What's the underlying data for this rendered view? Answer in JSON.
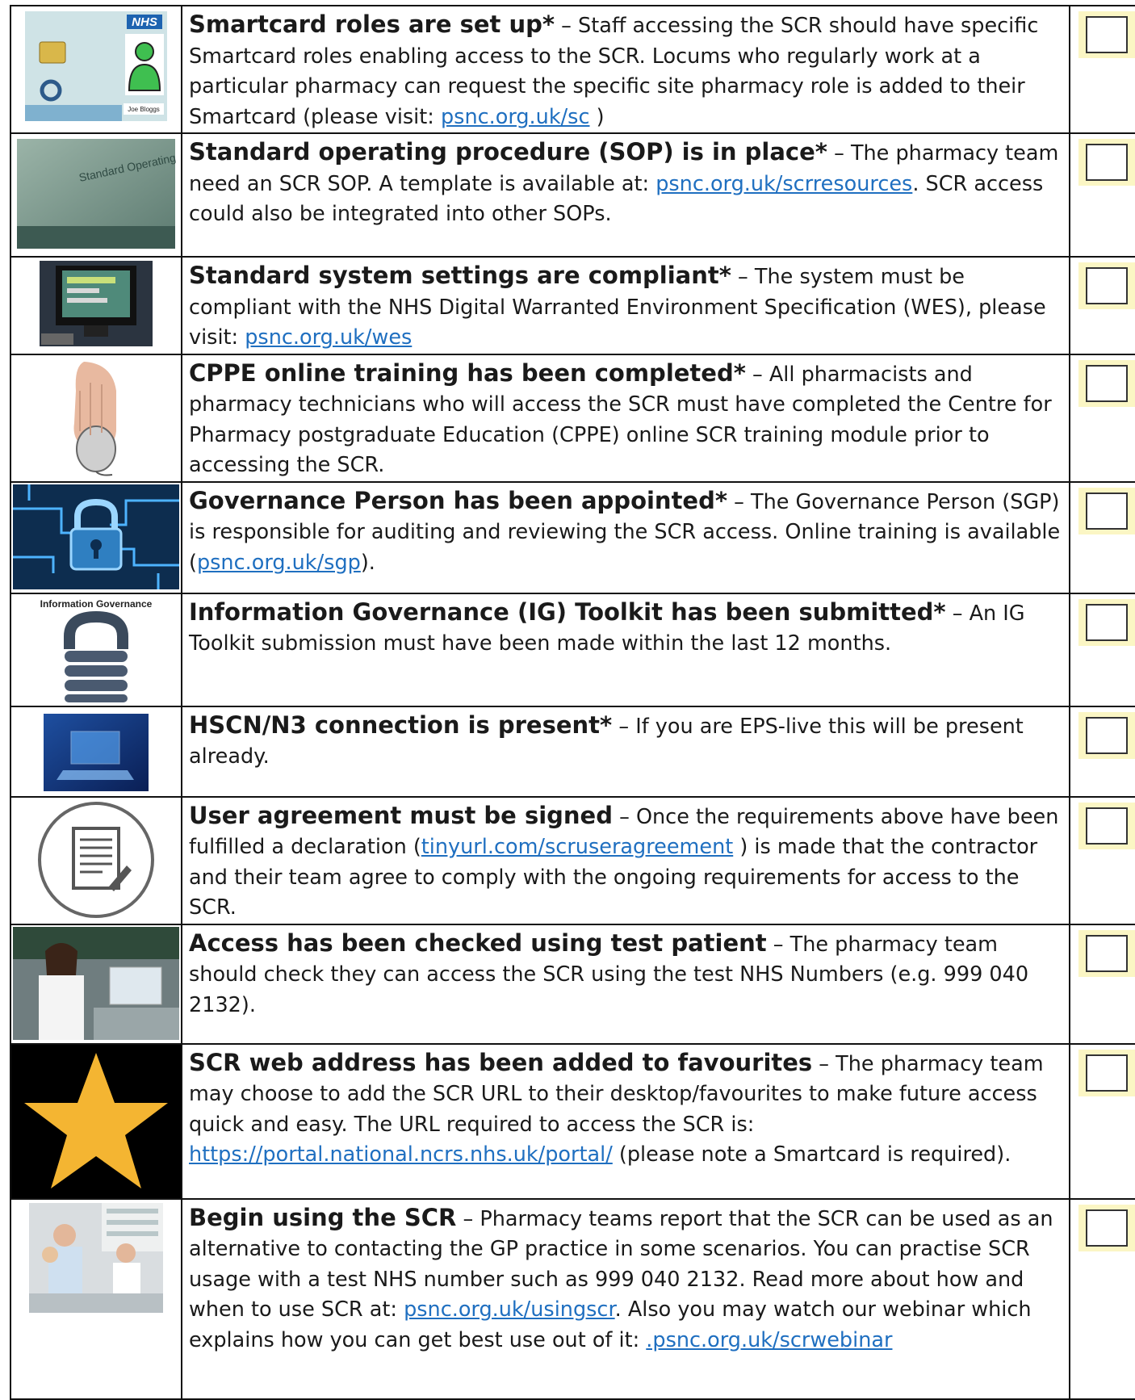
{
  "items": [
    {
      "title": "Smartcard roles are set up*",
      "dash": " – ",
      "body": "Staff accessing the SCR should have specific Smartcard roles enabling access to the SCR. Locums who regularly work at a particular pharmacy can request the specific site pharmacy role is added to their Smartcard (please visit: ",
      "link": "psnc.org.uk/sc",
      "after": " )",
      "image": {
        "icon": "nhs-smartcard-image",
        "nhs_label": "NHS",
        "card_name": "Joe Bloggs"
      }
    },
    {
      "title": "Standard operating procedure (SOP) is in place*",
      "dash": " – ",
      "body": "The pharmacy team need an SCR SOP. A template is available at: ",
      "link": "psnc.org.uk/scrresources",
      "after": ". SCR access could also be integrated into other SOPs.",
      "image": {
        "icon": "sop-binder-image",
        "caption": "Standard Operating Procedures"
      }
    },
    {
      "title": "Standard system settings are compliant*",
      "dash": " – ",
      "body": "The system must be compliant with the NHS Digital Warranted Environment Specification (WES), please visit: ",
      "link": "psnc.org.uk/wes",
      "after": "",
      "image": {
        "icon": "computer-monitor-image"
      }
    },
    {
      "title": "CPPE online training has been completed*",
      "dash": " – ",
      "body": "All pharmacists and pharmacy technicians who will access the SCR must have completed the Centre for Pharmacy postgraduate Education (CPPE) online SCR training module prior to accessing the SCR.",
      "link": "",
      "after": "",
      "image": {
        "icon": "hand-mouse-image"
      }
    },
    {
      "title": "Governance Person has been appointed*",
      "dash": " – ",
      "body": "The Governance Person (SGP) is responsible for auditing and reviewing the SCR access. Online training is available (",
      "link": "psnc.org.uk/sgp",
      "after": ").",
      "image": {
        "icon": "circuit-padlock-image"
      }
    },
    {
      "title": "Information Governance (IG) Toolkit has been submitted*",
      "dash": " – ",
      "body": "An IG Toolkit submission must have been made within the last 12 months.",
      "link": "",
      "after": "",
      "image": {
        "icon": "information-governance-lock-image",
        "caption": "Information Governance"
      }
    },
    {
      "title": "HSCN/N3 connection is present*",
      "dash": " – ",
      "body": "If you are EPS-live this will be present already.",
      "link": "",
      "after": "",
      "image": {
        "icon": "laptop-network-image"
      }
    },
    {
      "title": "User agreement must be signed",
      "dash": " – ",
      "body": "Once the requirements above have been fulfilled a declaration (",
      "link": "tinyurl.com/scruseragreement",
      "after": " ) is made that the contractor and their team agree to comply with the ongoing requirements for access to the SCR.",
      "image": {
        "icon": "signed-document-icon"
      }
    },
    {
      "title": "Access has been checked using test patient",
      "dash": " – ",
      "body": "The pharmacy team should check they can access the SCR using the test NHS Numbers (e.g. 999 040 2132).",
      "link": "",
      "after": "",
      "image": {
        "icon": "pharmacist-at-computer-image"
      }
    },
    {
      "title": "SCR web address has been added to favourites",
      "dash": " – ",
      "body": "The pharmacy team may choose to add the SCR URL to their desktop/favourites to make future access quick and easy. The URL required to access the SCR is: ",
      "link": "https://portal.national.ncrs.nhs.uk/portal/",
      "after": " (please note a Smartcard is required).",
      "image": {
        "icon": "star-icon"
      }
    },
    {
      "title": "Begin using the SCR",
      "dash": " – ",
      "body": "Pharmacy teams report that the SCR can be used as an alternative to contacting the GP practice in some scenarios. You can practise SCR usage with a test NHS number such as 999 040 2132. Read more about how and when to use SCR at: ",
      "link": "psnc.org.uk/usingscr",
      "after": ". Also you may watch our webinar which explains how you can get best use out of it: ",
      "link2": ".psnc.org.uk/scrwebinar",
      "image": {
        "icon": "pharmacy-counter-image"
      }
    }
  ],
  "colors": {
    "link": "#1f6fc0",
    "checkbox_fill": "#fbf6c4",
    "border": "#111111"
  }
}
